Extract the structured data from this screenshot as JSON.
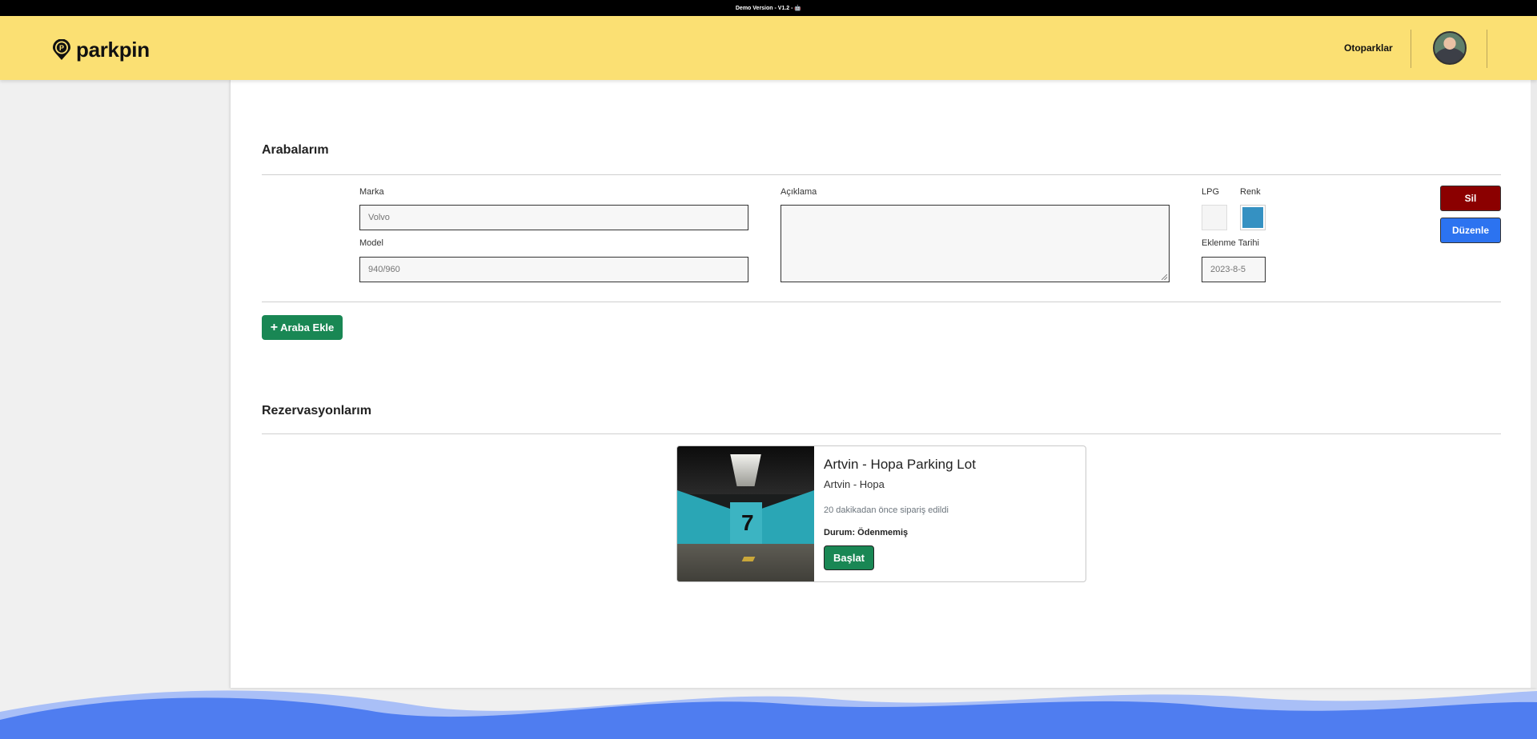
{
  "demo_banner": "Demo Version - V1.2 - 🤖",
  "brand": {
    "name": "parkpin",
    "icon": "pin-p-logo-icon"
  },
  "nav": {
    "link_label": "Otoparklar"
  },
  "user": {
    "avatar_icon": "user-avatar"
  },
  "cars_section": {
    "title": "Arabalarım",
    "car": {
      "marka_label": "Marka",
      "marka_placeholder": "Volvo",
      "model_label": "Model",
      "model_placeholder": "940/960",
      "aciklama_label": "Açıklama",
      "aciklama_value": "",
      "lpg_label": "LPG",
      "renk_label": "Renk",
      "renk_value": "#3591c2",
      "eklenme_label": "Eklenme Tarihi",
      "eklenme_placeholder": "2023-8-5",
      "delete_label": "Sil",
      "edit_label": "Düzenle"
    },
    "add_button_label": "Araba Ekle",
    "add_icon": "plus-icon"
  },
  "reservations_section": {
    "title": "Rezervasyonlarım",
    "card": {
      "image_icon": "parking-garage-photo",
      "title": "Artvin - Hopa Parking Lot",
      "location": "Artvin - Hopa",
      "ordered_text": "20 dakikadan önce sipariş edildi",
      "status_text": "Durum: Ödenmemiş",
      "start_button_label": "Başlat"
    }
  },
  "colors": {
    "navbar": "#fbe073",
    "delete": "#8b0000",
    "edit": "#2c73f0",
    "success": "#198754",
    "wave": "#4f7df0"
  }
}
